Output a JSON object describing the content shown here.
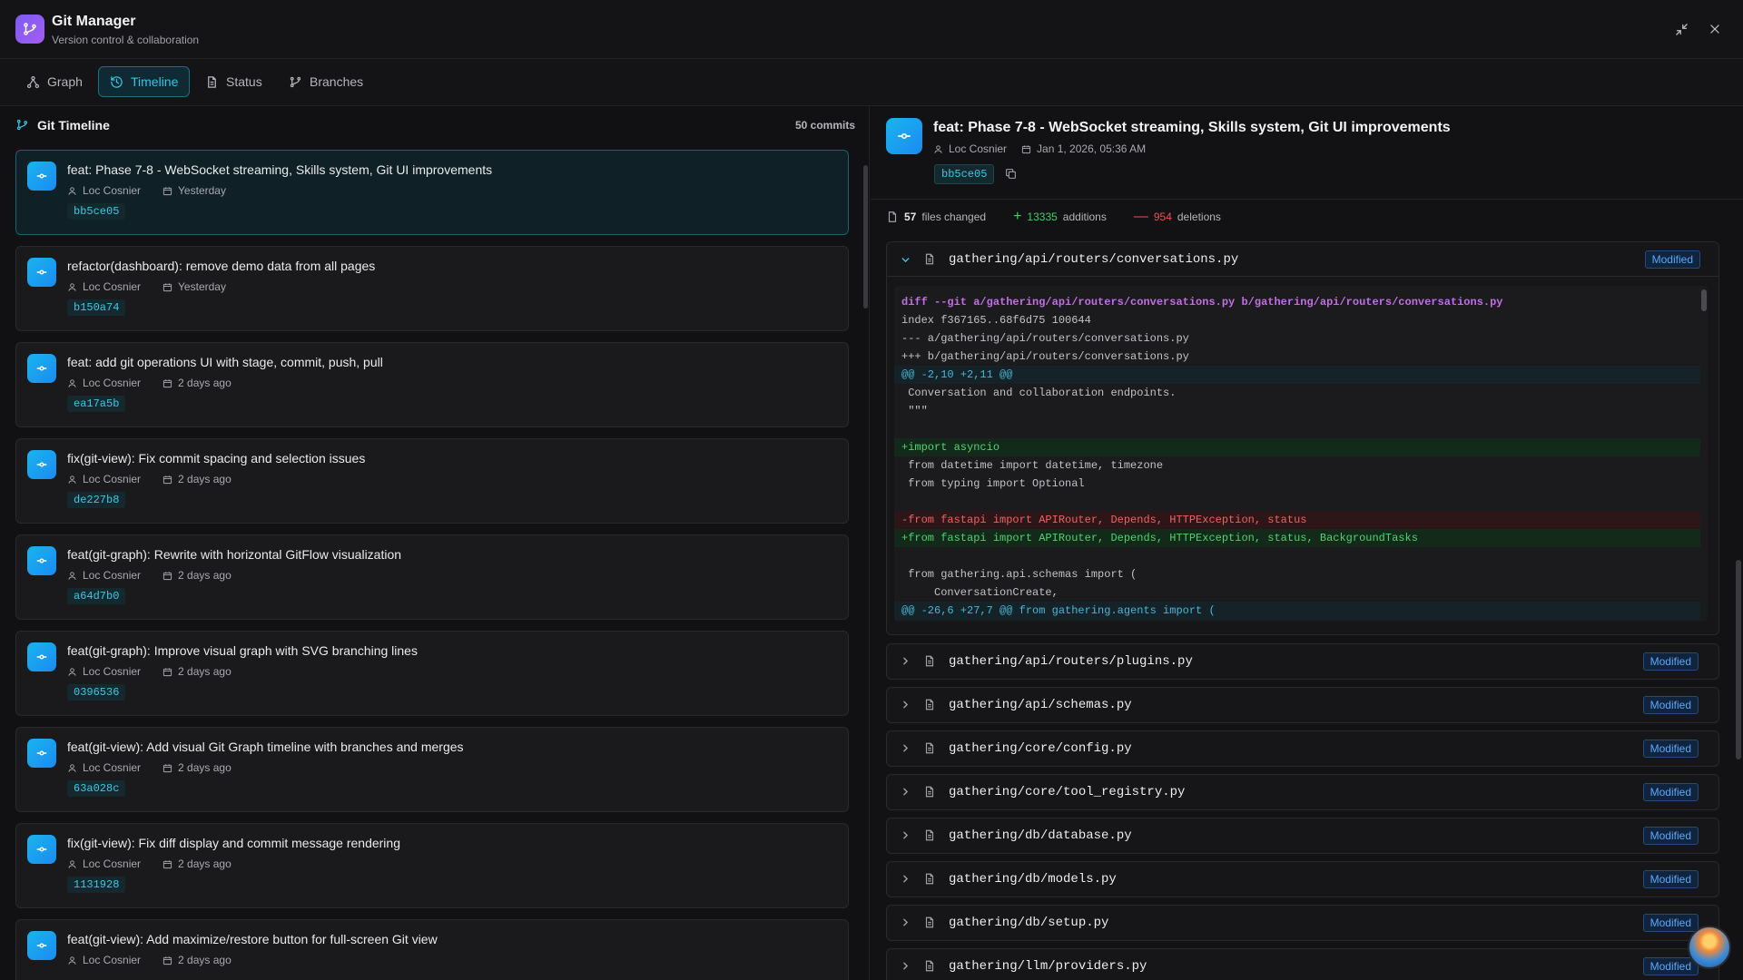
{
  "app": {
    "title": "Git Manager",
    "subtitle": "Version control & collaboration"
  },
  "tabs": [
    {
      "label": "Graph",
      "icon": "graph-icon"
    },
    {
      "label": "Timeline",
      "icon": "history-icon",
      "active": true
    },
    {
      "label": "Status",
      "icon": "file-icon"
    },
    {
      "label": "Branches",
      "icon": "branch-icon"
    }
  ],
  "timeline": {
    "title": "Git Timeline",
    "count": "50 commits",
    "commits": [
      {
        "message": "feat: Phase 7-8 - WebSocket streaming, Skills system, Git UI improvements",
        "author": "Loc Cosnier",
        "date": "Yesterday",
        "hash": "bb5ce05"
      },
      {
        "message": "refactor(dashboard): remove demo data from all pages",
        "author": "Loc Cosnier",
        "date": "Yesterday",
        "hash": "b150a74"
      },
      {
        "message": "feat: add git operations UI with stage, commit, push, pull",
        "author": "Loc Cosnier",
        "date": "2 days ago",
        "hash": "ea17a5b"
      },
      {
        "message": "fix(git-view): Fix commit spacing and selection issues",
        "author": "Loc Cosnier",
        "date": "2 days ago",
        "hash": "de227b8"
      },
      {
        "message": "feat(git-graph): Rewrite with horizontal GitFlow visualization",
        "author": "Loc Cosnier",
        "date": "2 days ago",
        "hash": "a64d7b0"
      },
      {
        "message": "feat(git-graph): Improve visual graph with SVG branching lines",
        "author": "Loc Cosnier",
        "date": "2 days ago",
        "hash": "0396536"
      },
      {
        "message": "feat(git-view): Add visual Git Graph timeline with branches and merges",
        "author": "Loc Cosnier",
        "date": "2 days ago",
        "hash": "63a028c"
      },
      {
        "message": "fix(git-view): Fix diff display and commit message rendering",
        "author": "Loc Cosnier",
        "date": "2 days ago",
        "hash": "1131928"
      },
      {
        "message": "feat(git-view): Add maximize/restore button for full-screen Git view",
        "author": "Loc Cosnier",
        "date": "2 days ago",
        "hash": ""
      }
    ]
  },
  "detail": {
    "title": "feat: Phase 7-8 - WebSocket streaming, Skills system, Git UI improvements",
    "author": "Loc Cosnier",
    "date": "Jan 1, 2026, 05:36 AM",
    "hash": "bb5ce05",
    "stats": {
      "files": "57",
      "files_label": "files changed",
      "additions": "13335",
      "additions_label": "additions",
      "deletions": "954",
      "deletions_label": "deletions"
    },
    "open_file": {
      "name": "gathering/api/routers/conversations.py",
      "status": "Modified",
      "diff": [
        {
          "t": "hdr",
          "text": "diff --git a/gathering/api/routers/conversations.py b/gathering/api/routers/conversations.py"
        },
        {
          "t": "ctx",
          "text": "index f367165..68f6d75 100644"
        },
        {
          "t": "ctx",
          "text": "--- a/gathering/api/routers/conversations.py"
        },
        {
          "t": "ctx",
          "text": "+++ b/gathering/api/routers/conversations.py"
        },
        {
          "t": "hunk",
          "text": "@@ -2,10 +2,11 @@"
        },
        {
          "t": "ctx",
          "text": " Conversation and collaboration endpoints."
        },
        {
          "t": "ctx",
          "text": " \"\"\""
        },
        {
          "t": "ctx",
          "text": " "
        },
        {
          "t": "add",
          "text": "+import asyncio"
        },
        {
          "t": "ctx",
          "text": " from datetime import datetime, timezone"
        },
        {
          "t": "ctx",
          "text": " from typing import Optional"
        },
        {
          "t": "ctx",
          "text": " "
        },
        {
          "t": "del",
          "text": "-from fastapi import APIRouter, Depends, HTTPException, status"
        },
        {
          "t": "add",
          "text": "+from fastapi import APIRouter, Depends, HTTPException, status, BackgroundTasks"
        },
        {
          "t": "ctx",
          "text": " "
        },
        {
          "t": "ctx",
          "text": " from gathering.api.schemas import ("
        },
        {
          "t": "ctx",
          "text": "     ConversationCreate,"
        },
        {
          "t": "hunk",
          "text": "@@ -26,6 +27,7 @@ from gathering.agents import ("
        }
      ]
    },
    "files": [
      {
        "name": "gathering/api/routers/plugins.py",
        "status": "Modified"
      },
      {
        "name": "gathering/api/schemas.py",
        "status": "Modified"
      },
      {
        "name": "gathering/core/config.py",
        "status": "Modified"
      },
      {
        "name": "gathering/core/tool_registry.py",
        "status": "Modified"
      },
      {
        "name": "gathering/db/database.py",
        "status": "Modified"
      },
      {
        "name": "gathering/db/models.py",
        "status": "Modified"
      },
      {
        "name": "gathering/db/setup.py",
        "status": "Modified"
      },
      {
        "name": "gathering/llm/providers.py",
        "status": "Modified"
      }
    ]
  },
  "colors": {
    "accent": "#39c3e6",
    "add": "#3ecf62",
    "del": "#ef4f4f",
    "badge": "#57a8ff"
  }
}
